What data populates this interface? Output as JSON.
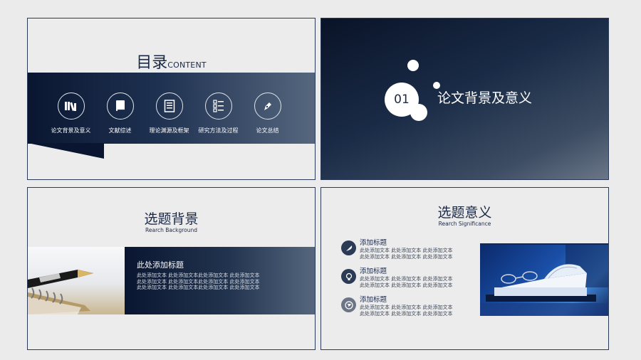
{
  "slide_toc": {
    "title": "目录",
    "title_en": "CONTENT",
    "items": [
      {
        "label": "论文背景及意义",
        "icon": "books-icon"
      },
      {
        "label": "文献综述",
        "icon": "book-icon"
      },
      {
        "label": "理论渊源及框架",
        "icon": "document-icon"
      },
      {
        "label": "研究方法及过程",
        "icon": "list-icon"
      },
      {
        "label": "论文总结",
        "icon": "pen-icon"
      }
    ]
  },
  "slide_section": {
    "number": "01",
    "title": "论文背景及意义"
  },
  "slide_background": {
    "title": "选题背景",
    "subtitle": "Rearch Background",
    "panel_title": "此处添加标题",
    "panel_lines": [
      "此处添加文本 此处添加文本此处添加文本 此处添加文本",
      "此处添加文本 此处添加文本此处添加文本 此处添加文本",
      "此处添加文本 此处添加文本此处添加文本 此处添加文本"
    ]
  },
  "slide_significance": {
    "title": "选题意义",
    "subtitle": "Rearch Significance",
    "items": [
      {
        "title": "添加标题",
        "icon": "feather-icon",
        "lines": [
          "此处添加文本 此处添加文本 此处添加文本",
          "此处添加文本 此处添加文本 此处添加文本"
        ]
      },
      {
        "title": "添加标题",
        "icon": "lightbulb-icon",
        "lines": [
          "此处添加文本 此处添加文本 此处添加文本",
          "此处添加文本 此处添加文本 此处添加文本"
        ]
      },
      {
        "title": "添加标题",
        "icon": "globe-icon",
        "lines": [
          "此处添加文本 此处添加文本 此处添加文本",
          "此处添加文本 此处添加文本 此处添加文本"
        ]
      }
    ]
  }
}
